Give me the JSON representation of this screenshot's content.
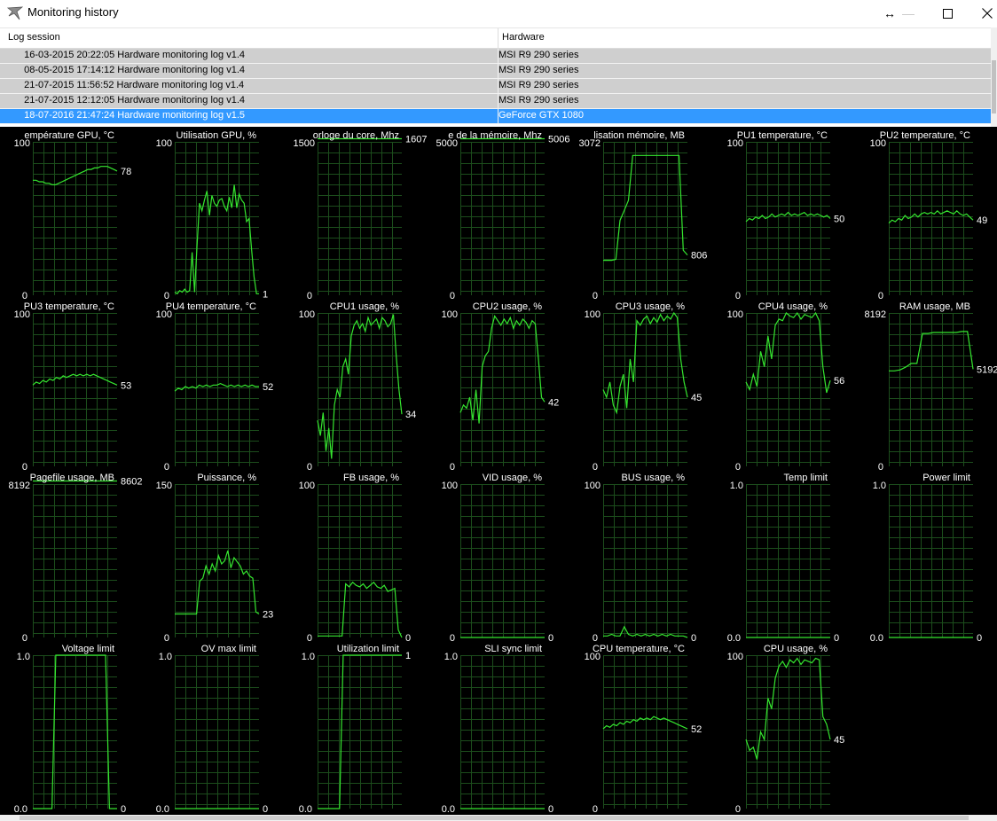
{
  "window": {
    "title": "Monitoring history",
    "controls": {
      "move": "↔",
      "minimize": "—"
    }
  },
  "table": {
    "columns": [
      "Log session",
      "Hardware"
    ],
    "rows": [
      {
        "session": "  16-03-2015 20:22:05 Hardware monitoring log v1.4",
        "hardware": "MSI R9 290 series",
        "selected": false
      },
      {
        "session": "  08-05-2015 17:14:12 Hardware monitoring log v1.4",
        "hardware": "MSI R9 290 series",
        "selected": false
      },
      {
        "session": "  21-07-2015 11:56:52 Hardware monitoring log v1.4",
        "hardware": "MSI R9 290 series",
        "selected": false
      },
      {
        "session": "  21-07-2015 12:12:05 Hardware monitoring log v1.4",
        "hardware": "MSI R9 290 series",
        "selected": false
      },
      {
        "session": "  18-07-2016 21:47:24 Hardware monitoring log v1.5",
        "hardware": "GeForce GTX 1080",
        "selected": true
      }
    ]
  },
  "colors": {
    "line": "#35e62f",
    "grid": "#1c4d1c",
    "background": "#000000",
    "text": "#ffffff",
    "selection": "#3399ff"
  },
  "chart_data": [
    {
      "type": "line",
      "title": "empérature GPU, °C",
      "max": "100",
      "min": "0",
      "current": "78",
      "values": [
        75,
        75,
        74,
        74,
        73,
        73,
        72,
        72,
        73,
        74,
        75,
        76,
        77,
        78,
        79,
        80,
        81,
        82,
        82,
        83,
        83,
        84,
        84,
        84,
        83,
        82,
        81
      ]
    },
    {
      "type": "line",
      "title": "Utilisation GPU, %",
      "max": "100",
      "min": "0",
      "current": "1",
      "values": [
        2,
        1,
        3,
        2,
        4,
        2,
        3,
        28,
        2,
        32,
        60,
        55,
        62,
        68,
        52,
        65,
        60,
        58,
        62,
        63,
        58,
        55,
        64,
        57,
        72,
        57,
        66,
        62,
        60,
        48,
        50,
        30,
        12,
        1,
        1
      ]
    },
    {
      "type": "line",
      "title": "orloge du core, Mhz",
      "max": "1500",
      "min": "0",
      "current": "1607",
      "values": [
        1607,
        1607,
        1607,
        1607,
        1607,
        1607,
        1607,
        1607,
        1607,
        1607
      ]
    },
    {
      "type": "line",
      "title": "e de la mémoire, Mhz",
      "max": "5000",
      "min": "0",
      "current": "5006",
      "values": [
        5006,
        5006,
        5006,
        5006,
        5006,
        5006,
        5006,
        5006,
        5006,
        5006
      ]
    },
    {
      "type": "line",
      "title": "lisation mémoire, MB",
      "max": "3072",
      "min": "0",
      "current": "806",
      "values": [
        700,
        700,
        700,
        720,
        1500,
        1700,
        1900,
        2800,
        2800,
        2800,
        2800,
        2800,
        2800,
        2800,
        2800,
        2800,
        2800,
        2800,
        2800,
        900,
        806
      ]
    },
    {
      "type": "line",
      "title": "PU1 temperature, °C",
      "max": "100",
      "min": "0",
      "current": "50",
      "values": [
        48,
        50,
        49,
        51,
        50,
        52,
        50,
        51,
        53,
        51,
        52,
        53,
        52,
        54,
        52,
        53,
        52,
        53,
        54,
        52,
        53,
        52,
        53,
        52,
        51,
        52,
        50
      ]
    },
    {
      "type": "line",
      "title": "PU2 temperature, °C",
      "max": "100",
      "min": "0",
      "current": "49",
      "values": [
        47,
        49,
        48,
        50,
        49,
        52,
        50,
        51,
        53,
        51,
        53,
        54,
        53,
        54,
        53,
        55,
        53,
        54,
        55,
        54,
        53,
        55,
        53,
        52,
        53,
        51,
        49
      ]
    },
    {
      "type": "line",
      "title": "PU3 temperature, °C",
      "max": "100",
      "min": "0",
      "current": "53",
      "values": [
        53,
        55,
        54,
        56,
        55,
        57,
        56,
        58,
        57,
        59,
        58,
        59,
        60,
        59,
        60,
        59,
        60,
        59,
        60,
        59,
        58,
        57,
        56,
        55,
        54,
        53
      ]
    },
    {
      "type": "line",
      "title": "PU4 temperature, °C",
      "max": "100",
      "min": "0",
      "current": "52",
      "values": [
        49,
        51,
        50,
        52,
        51,
        52,
        51,
        53,
        52,
        53,
        52,
        53,
        53,
        54,
        53,
        52,
        53,
        52,
        53,
        52,
        53,
        52,
        53,
        52,
        52
      ]
    },
    {
      "type": "line",
      "title": "CPU1 usage, %",
      "max": "100",
      "min": "0",
      "current": "34",
      "values": [
        30,
        20,
        35,
        10,
        25,
        5,
        40,
        50,
        45,
        65,
        70,
        60,
        85,
        92,
        95,
        90,
        93,
        88,
        97,
        92,
        94,
        96,
        90,
        97,
        95,
        91,
        93,
        99,
        72,
        50,
        34
      ]
    },
    {
      "type": "line",
      "title": "CPU2 usage, %",
      "max": "100",
      "min": "0",
      "current": "42",
      "values": [
        35,
        40,
        38,
        45,
        30,
        50,
        28,
        65,
        72,
        75,
        90,
        98,
        95,
        92,
        96,
        93,
        97,
        90,
        95,
        92,
        96,
        94,
        90,
        95,
        93,
        70,
        45,
        42
      ]
    },
    {
      "type": "line",
      "title": "CPU3 usage, %",
      "max": "100",
      "min": "0",
      "current": "45",
      "values": [
        50,
        45,
        55,
        40,
        35,
        52,
        60,
        38,
        70,
        55,
        95,
        92,
        96,
        98,
        93,
        97,
        94,
        99,
        95,
        98,
        96,
        100,
        97,
        70,
        55,
        45
      ]
    },
    {
      "type": "line",
      "title": "CPU4 usage, %",
      "max": "100",
      "min": "0",
      "current": "56",
      "values": [
        55,
        50,
        60,
        52,
        75,
        65,
        85,
        70,
        92,
        96,
        95,
        100,
        98,
        97,
        100,
        96,
        99,
        98,
        97,
        100,
        95,
        65,
        48,
        56
      ]
    },
    {
      "type": "line",
      "title": "RAM usage, MB",
      "max": "8192",
      "min": "0",
      "current": "5192",
      "values": [
        5100,
        5100,
        5150,
        5300,
        5500,
        5500,
        7100,
        7100,
        7150,
        7150,
        7150,
        7150,
        7150,
        7200,
        7200,
        5192
      ]
    },
    {
      "type": "line",
      "title": "Pagefile usage, MB",
      "max": "8192",
      "min": "0",
      "current": "8602",
      "values": [
        8602,
        8602,
        8602,
        8602,
        8602,
        8602,
        8602,
        8602,
        8602,
        8602
      ]
    },
    {
      "type": "line",
      "title": "Puissance, %",
      "max": "150",
      "min": "0",
      "current": "23",
      "values": [
        23,
        23,
        23,
        23,
        23,
        23,
        23,
        23,
        55,
        58,
        70,
        62,
        72,
        65,
        80,
        72,
        75,
        85,
        68,
        78,
        74,
        70,
        62,
        65,
        60,
        58,
        25,
        23
      ]
    },
    {
      "type": "line",
      "title": "FB usage, %",
      "max": "100",
      "min": "0",
      "current": "0",
      "values": [
        1,
        1,
        1,
        1,
        1,
        1,
        1,
        1,
        35,
        33,
        36,
        34,
        33,
        35,
        32,
        34,
        36,
        33,
        32,
        34,
        30,
        31,
        32,
        5,
        0
      ]
    },
    {
      "type": "line",
      "title": "VID usage, %",
      "max": "100",
      "min": "0",
      "current": "0",
      "values": [
        0,
        0,
        0,
        0,
        0,
        0,
        0,
        0,
        0,
        0
      ]
    },
    {
      "type": "line",
      "title": "BUS usage, %",
      "max": "100",
      "min": "0",
      "current": "0",
      "values": [
        1,
        1,
        2,
        1,
        1,
        7,
        2,
        1,
        2,
        1,
        2,
        1,
        2,
        1,
        2,
        1,
        2,
        1,
        1,
        1,
        0
      ]
    },
    {
      "type": "line",
      "title": "Temp limit",
      "max": "1.0",
      "min": "0.0",
      "current": "0",
      "values": [
        0,
        0,
        0,
        0,
        0,
        0,
        0,
        0,
        0,
        0
      ]
    },
    {
      "type": "line",
      "title": "Power limit",
      "max": "1.0",
      "min": "0.0",
      "current": "0",
      "values": [
        0,
        0,
        0,
        0,
        0,
        0,
        0,
        0,
        0,
        0
      ]
    },
    {
      "type": "line",
      "title": "Voltage limit",
      "max": "1.0",
      "min": "0.0",
      "current": "0",
      "values": [
        0,
        0,
        0,
        0,
        0,
        0,
        1,
        1,
        1,
        1,
        1,
        1,
        1,
        1,
        1,
        1,
        1,
        1,
        1,
        1,
        0,
        0,
        0
      ]
    },
    {
      "type": "line",
      "title": "OV max limit",
      "max": "1.0",
      "min": "0.0",
      "current": "0",
      "values": [
        0,
        0,
        0,
        0,
        0,
        0,
        0,
        0,
        0,
        0
      ]
    },
    {
      "type": "line",
      "title": "Utilization limit",
      "max": "1.0",
      "min": "0.0",
      "current": "1",
      "values": [
        0,
        0,
        0,
        0,
        0,
        0,
        0,
        1,
        1,
        1,
        1,
        1,
        1,
        1,
        1,
        1,
        1,
        1,
        1,
        1,
        1,
        1,
        1,
        1
      ]
    },
    {
      "type": "line",
      "title": "SLI sync limit",
      "max": "1.0",
      "min": "0.0",
      "current": "0",
      "values": [
        0,
        0,
        0,
        0,
        0,
        0,
        0,
        0,
        0,
        0
      ]
    },
    {
      "type": "line",
      "title": "CPU temperature, °C",
      "max": "100",
      "min": "0",
      "current": "52",
      "values": [
        52,
        54,
        53,
        55,
        54,
        56,
        55,
        57,
        56,
        58,
        57,
        59,
        58,
        59,
        58,
        60,
        59,
        58,
        59,
        58,
        57,
        56,
        55,
        54,
        53,
        52
      ]
    },
    {
      "type": "line",
      "title": "CPU usage, %",
      "max": "100",
      "min": "0",
      "current": "45",
      "values": [
        45,
        38,
        40,
        32,
        50,
        45,
        72,
        65,
        85,
        93,
        96,
        92,
        97,
        95,
        98,
        94,
        97,
        96,
        95,
        98,
        97,
        60,
        55,
        45
      ]
    }
  ]
}
